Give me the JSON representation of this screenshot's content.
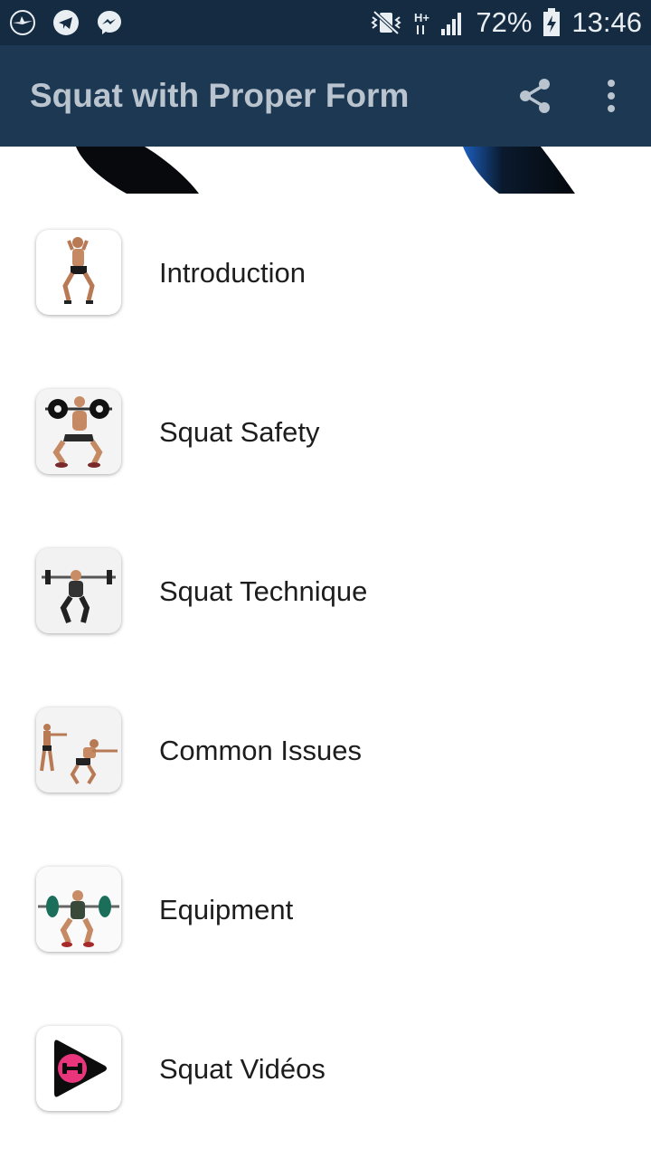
{
  "status_bar": {
    "battery": "72%",
    "time": "13:46",
    "network": "H+"
  },
  "app_bar": {
    "title": "Squat with Proper Form",
    "share_icon": "share-icon",
    "more_icon": "more-vert-icon"
  },
  "colors": {
    "status_bar_bg": "#142b41",
    "app_bar_bg": "#1c3852",
    "title_text": "#b9c4cf",
    "item_text": "#1d1d1d",
    "video_accent": "#e8357c"
  },
  "menu": {
    "items": [
      {
        "label": "Introduction",
        "icon": "squat-figure-thumbnail"
      },
      {
        "label": "Squat Safety",
        "icon": "front-squat-barbell-thumbnail"
      },
      {
        "label": "Squat Technique",
        "icon": "back-squat-barbell-thumbnail"
      },
      {
        "label": "Common Issues",
        "icon": "squat-comparison-thumbnail"
      },
      {
        "label": "Equipment",
        "icon": "barbell-equipment-thumbnail"
      },
      {
        "label": "Squat Vidéos",
        "icon": "video-play-icon"
      }
    ]
  }
}
